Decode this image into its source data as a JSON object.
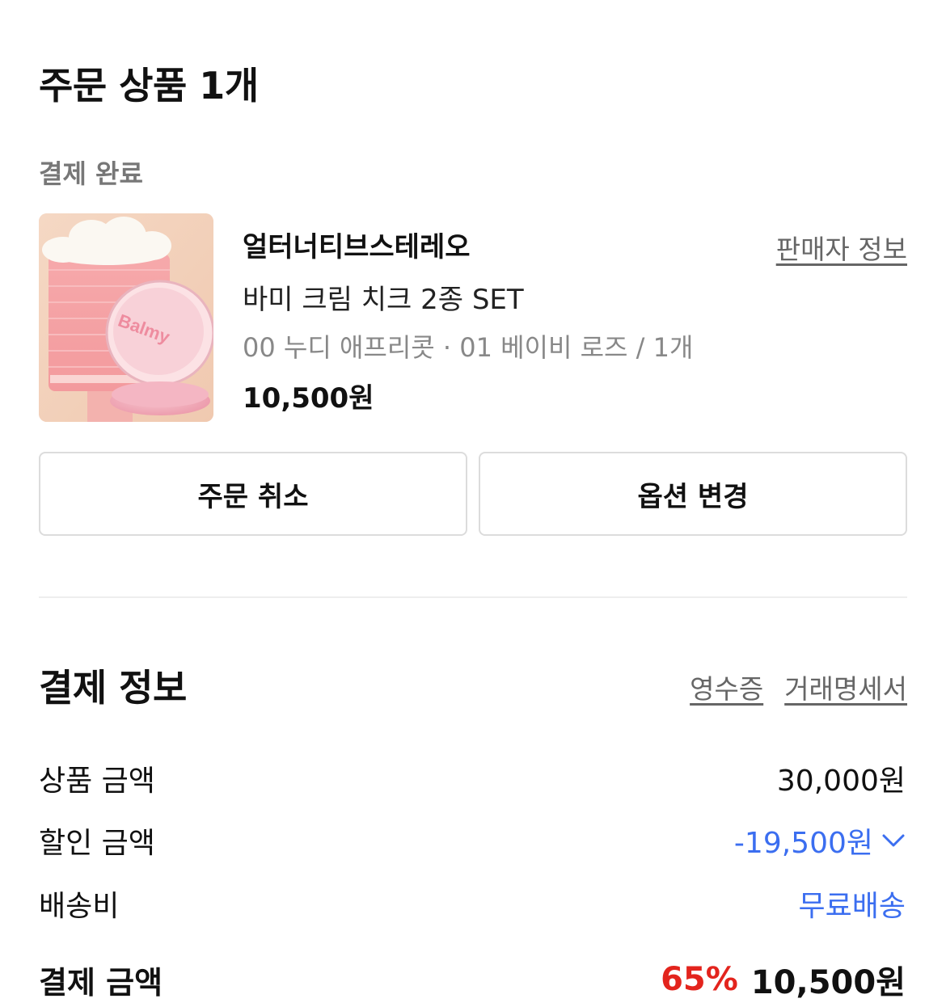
{
  "order": {
    "title": "주문 상품 1개",
    "status": "결제 완료",
    "seller_info_link": "판매자 정보",
    "product": {
      "seller": "얼터너티브스테레오",
      "name": "바미 크림 치크 2종 SET",
      "option": "00 누디 애프리콧 · 01 베이비 로즈 / 1개",
      "price": "10,500원",
      "image_brand_text": "Balmy"
    },
    "buttons": {
      "cancel": "주문 취소",
      "change_option": "옵션 변경"
    }
  },
  "payment": {
    "title": "결제 정보",
    "links": {
      "receipt": "영수증",
      "statement": "거래명세서"
    },
    "rows": {
      "product_amount": {
        "label": "상품 금액",
        "value": "30,000원"
      },
      "discount_amount": {
        "label": "할인 금액",
        "value": "-19,500원"
      },
      "shipping": {
        "label": "배송비",
        "value": "무료배송"
      }
    },
    "total": {
      "label": "결제 금액",
      "discount_rate": "65%",
      "value": "10,500원"
    }
  },
  "colors": {
    "accent_blue": "#3b6ef0",
    "discount_red": "#e3241d"
  },
  "icons": {
    "discount_toggle": "chevron-down-icon"
  }
}
